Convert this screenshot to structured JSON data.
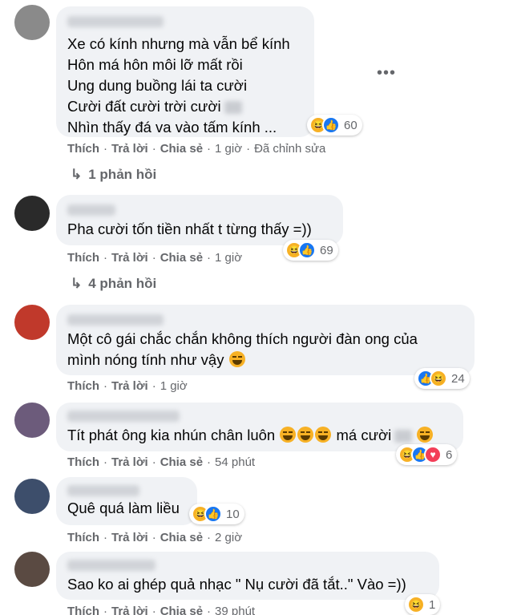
{
  "comments": [
    {
      "lines": [
        "Xe có kính nhưng mà vẫn bể kính",
        "Hôn má hôn môi lỡ mất rồi",
        "Ung dung buồng lái ta cười",
        "Cười đất cười trời cười",
        "Nhìn thấy đá va vào tấm kính ..."
      ],
      "actions": {
        "like": "Thích",
        "reply": "Trả lời",
        "share": "Chia sẻ",
        "time": "1 giờ",
        "edited": "Đã chỉnh sửa"
      },
      "reactions": {
        "icons": [
          "haha-icon",
          "like-icon"
        ],
        "count": "60"
      },
      "replies": "1 phản hồi"
    },
    {
      "lines": [
        "Pha cười tốn tiền nhất t từng thấy =))"
      ],
      "actions": {
        "like": "Thích",
        "reply": "Trả lời",
        "share": "Chia sẻ",
        "time": "1 giờ"
      },
      "reactions": {
        "icons": [
          "haha-icon",
          "like-icon"
        ],
        "count": "69"
      },
      "replies": "4 phản hồi"
    },
    {
      "lines": [
        "Một cô gái chắc chắn không thích người đàn ong của",
        "mình nóng tính như vậy"
      ],
      "actions": {
        "like": "Thích",
        "reply": "Trả lời",
        "time": "1 giờ"
      },
      "reactions": {
        "icons": [
          "like-icon",
          "haha-icon"
        ],
        "count": "24"
      }
    },
    {
      "lines": [
        "Tít phát ông kia nhún chân luôn",
        "má cười"
      ],
      "actions": {
        "like": "Thích",
        "reply": "Trả lời",
        "share": "Chia sẻ",
        "time": "54 phút"
      },
      "reactions": {
        "icons": [
          "haha-icon",
          "like-icon",
          "love-icon"
        ],
        "count": "6"
      }
    },
    {
      "lines": [
        "Quê quá làm liều"
      ],
      "actions": {
        "like": "Thích",
        "reply": "Trả lời",
        "share": "Chia sẻ",
        "time": "2 giờ"
      },
      "reactions": {
        "icons": [
          "haha-icon",
          "like-icon"
        ],
        "count": "10"
      }
    },
    {
      "lines": [
        "Sao ko ai ghép quả nhạc \" Nụ cười đã tắt..\" Vào =))"
      ],
      "actions": {
        "like": "Thích",
        "reply": "Trả lời",
        "share": "Chia sẻ",
        "time": "39 phút"
      },
      "reactions": {
        "icons": [
          "haha-icon"
        ],
        "count": "1"
      }
    }
  ],
  "more_menu": "•••",
  "colors": {
    "bubble": "#f0f2f5",
    "meta": "#65676b",
    "like": "#1877f2",
    "haha": "#f7b125",
    "love": "#f33e58"
  }
}
